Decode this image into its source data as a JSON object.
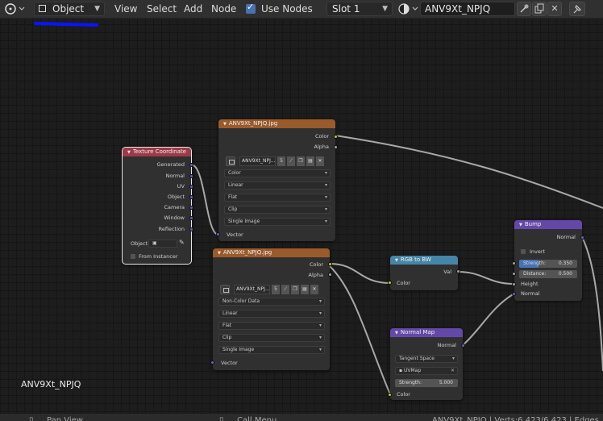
{
  "header": {
    "editor_type_icon": "node-editor-icon",
    "object_icon": "object-cube-icon",
    "object_mode_label": "Object",
    "menus": [
      "View",
      "Select",
      "Add",
      "Node"
    ],
    "use_nodes_label": "Use Nodes",
    "use_nodes_checked": true,
    "slot_label": "Slot 1",
    "material_icon": "material-sphere-icon",
    "material_name": "ANV9Xt_NPJQ",
    "fake_user_icon": "fake-user-icon",
    "duplicate_icon": "duplicate-icon",
    "unlink_icon": "close-icon",
    "pin_icon": "pin-icon"
  },
  "scene_label": "ANV9Xt_NPJQ",
  "status": {
    "pan_view": "Pan View",
    "call_menu": "Call Menu",
    "stats": "ANV9Xt_NPJQ | Verts:6,423/6,423 | Edges"
  },
  "nodes": {
    "texcoord": {
      "title": "Texture Coordinate",
      "outputs": [
        "Generated",
        "Normal",
        "UV",
        "Object",
        "Camera",
        "Window",
        "Reflection"
      ],
      "object_label": "Object:",
      "from_instancer": "From Instancer"
    },
    "image1": {
      "title": "ANV9Xt_NPJQ.jpg",
      "outputs": [
        "Color",
        "Alpha"
      ],
      "image_name": "ANV9Xt_NPJ...",
      "users": "5",
      "color_space": "Color",
      "interpolation": "Linear",
      "projection": "Flat",
      "extension": "Clip",
      "source": "Single Image",
      "input": "Vector"
    },
    "image2": {
      "title": "ANV9Xt_NPJQ.jpg",
      "outputs": [
        "Color",
        "Alpha"
      ],
      "image_name": "ANV9Xt_NPJ...",
      "users": "5",
      "color_space": "Non-Color Data",
      "interpolation": "Linear",
      "projection": "Flat",
      "extension": "Clip",
      "source": "Single Image",
      "input": "Vector"
    },
    "rgbbw": {
      "title": "RGB to BW",
      "output": "Val",
      "input": "Color"
    },
    "normalmap": {
      "title": "Normal Map",
      "output": "Normal",
      "space": "Tangent Space",
      "uvmap": "UVMap",
      "strength_label": "Strength:",
      "strength": "5.000",
      "input": "Color"
    },
    "bump": {
      "title": "Bump",
      "output": "Normal",
      "invert": "Invert",
      "strength_label": "Strength:",
      "strength": "0.350",
      "distance_label": "Distance:",
      "distance": "0.500",
      "inputs": [
        "Height",
        "Normal"
      ]
    }
  },
  "colors": {
    "annotation_stroke": "#0a14ff",
    "texture_header": "#9b5a2a",
    "input_header": "#9d3a47",
    "converter_header": "#4585a7",
    "vector_header": "#6448a8"
  }
}
